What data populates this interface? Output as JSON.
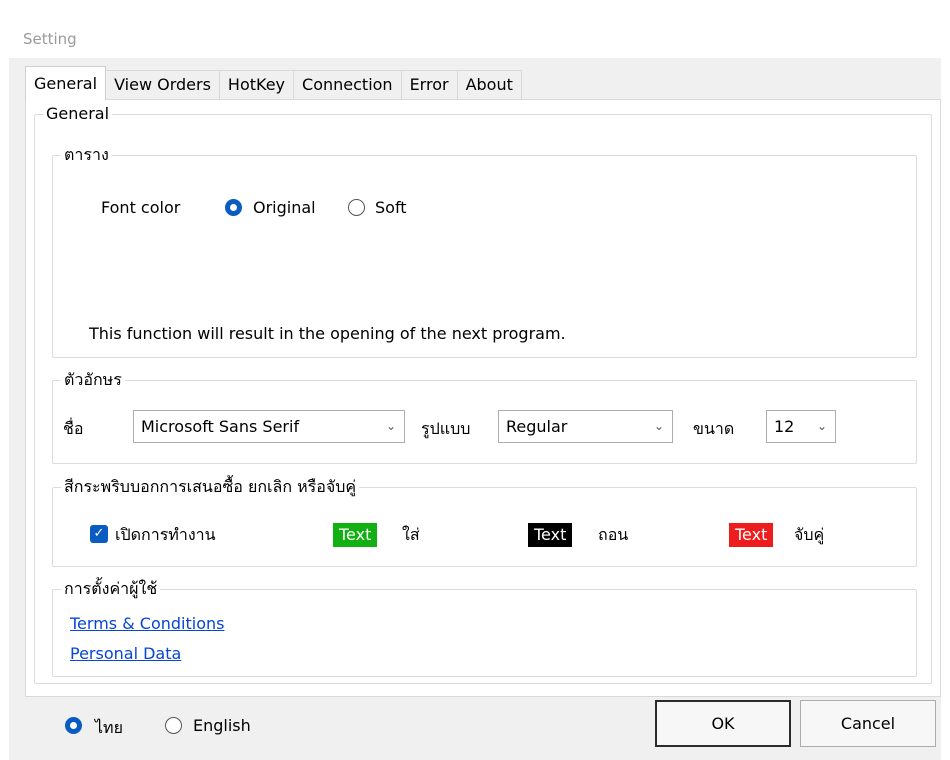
{
  "window": {
    "title": "Setting"
  },
  "tabs": [
    "General",
    "View Orders",
    "HotKey",
    "Connection",
    "Error",
    "About"
  ],
  "general": {
    "legend": "General",
    "table_group": {
      "legend": "ตาราง",
      "font_color_label": "Font color",
      "options": [
        "Original",
        "Soft"
      ],
      "selected": "Original",
      "note": "This function will result in the opening of the next program."
    },
    "font_group": {
      "legend": "ตัวอักษร",
      "name_label": "ชื่อ",
      "name_value": "Microsoft Sans Serif",
      "style_label": "รูปแบบ",
      "style_value": "Regular",
      "size_label": "ขนาด",
      "size_value": "12"
    },
    "blink_group": {
      "legend": "สีกระพริบบอกการเสนอซื้อ ยกเลิก หรือจับคู่",
      "enable_label": "เปิดการทำงาน",
      "enabled": true,
      "swatches": [
        {
          "text": "Text",
          "label": "ใส่",
          "bg": "#13b013",
          "fg": "#ffffff"
        },
        {
          "text": "Text",
          "label": "ถอน",
          "bg": "#000000",
          "fg": "#ffffff"
        },
        {
          "text": "Text",
          "label": "จับคู่",
          "bg": "#ee1c1c",
          "fg": "#ffffff"
        }
      ]
    },
    "user_group": {
      "legend": "การตั้งค่าผู้ใช้",
      "links": [
        "Terms & Conditions",
        "Personal Data"
      ]
    }
  },
  "footer": {
    "languages": [
      "ไทย",
      "English"
    ],
    "selected_language": "ไทย",
    "ok_label": "OK",
    "cancel_label": "Cancel"
  },
  "colors": {
    "accent": "#0a5cc2",
    "link": "#0645d6"
  }
}
